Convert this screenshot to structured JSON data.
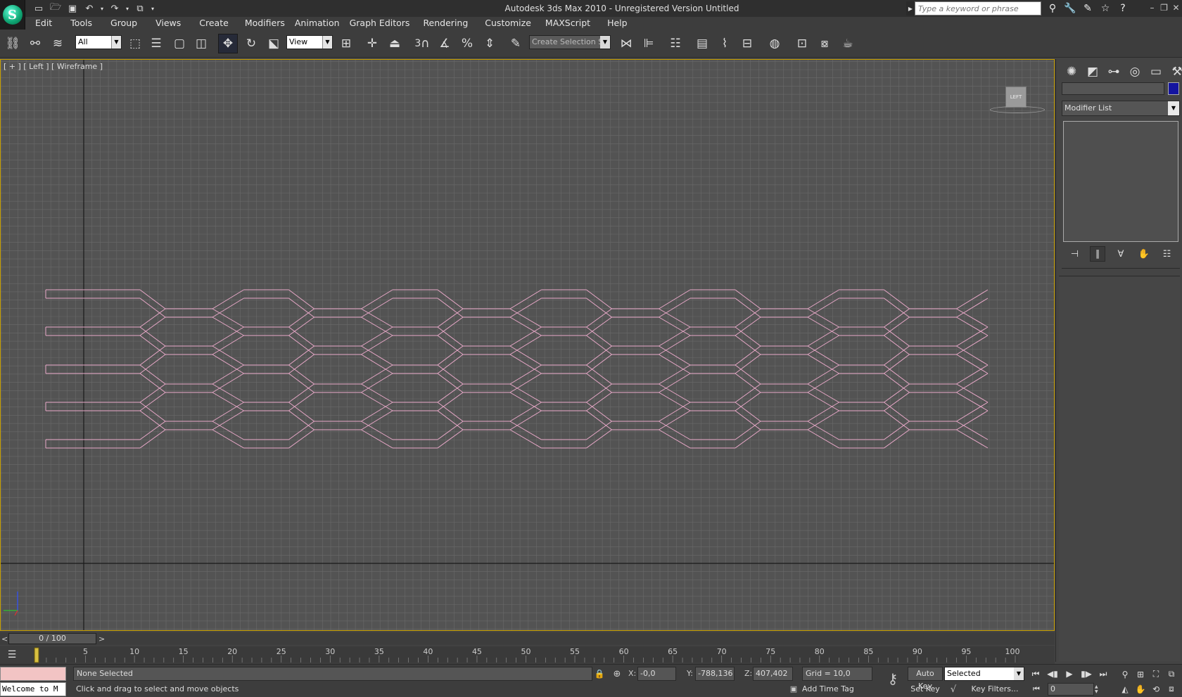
{
  "window": {
    "title": "Autodesk 3ds Max  2010   - Unregistered Version    Untitled"
  },
  "search": {
    "placeholder": "Type a keyword or phrase"
  },
  "menu": {
    "items": [
      "Edit",
      "Tools",
      "Group",
      "Views",
      "Create",
      "Modifiers",
      "Animation",
      "Graph Editors",
      "Rendering",
      "Customize",
      "MAXScript",
      "Help"
    ]
  },
  "toolbar": {
    "selection_filter": "All",
    "ref_coord": "View",
    "named_selection_placeholder": "Create Selection Se",
    "snap_label": "3"
  },
  "viewport": {
    "label": "[ + ] [ Left ] [ Wireframe ]",
    "viewcube_label": "LEFT",
    "wire_color": "#e8a8c8",
    "grid_color": "#6a6a6a",
    "background": "#535353"
  },
  "command_panel": {
    "modifier_list": "Modifier List",
    "object_color": "#1414a0"
  },
  "timeline": {
    "slider_text": "0 / 100",
    "ticks": [
      5,
      10,
      15,
      20,
      25,
      30,
      35,
      40,
      45,
      50,
      55,
      60,
      65,
      70,
      75,
      80,
      85,
      90,
      95,
      100
    ],
    "current_frame_marker": "0"
  },
  "status": {
    "listener": "Welcome to M",
    "selection": "None Selected",
    "prompt": "Click and drag to select and move objects",
    "x_label": "X:",
    "x_value": "-0,0",
    "y_label": "Y:",
    "y_value": "-788,136",
    "z_label": "Z:",
    "z_value": "407,402",
    "grid": "Grid = 10,0",
    "add_time_tag": "Add Time Tag",
    "auto_key": "Auto Key",
    "set_key": "Set Key",
    "key_mode": "Selected",
    "key_filters": "Key Filters...",
    "frame": "0"
  }
}
